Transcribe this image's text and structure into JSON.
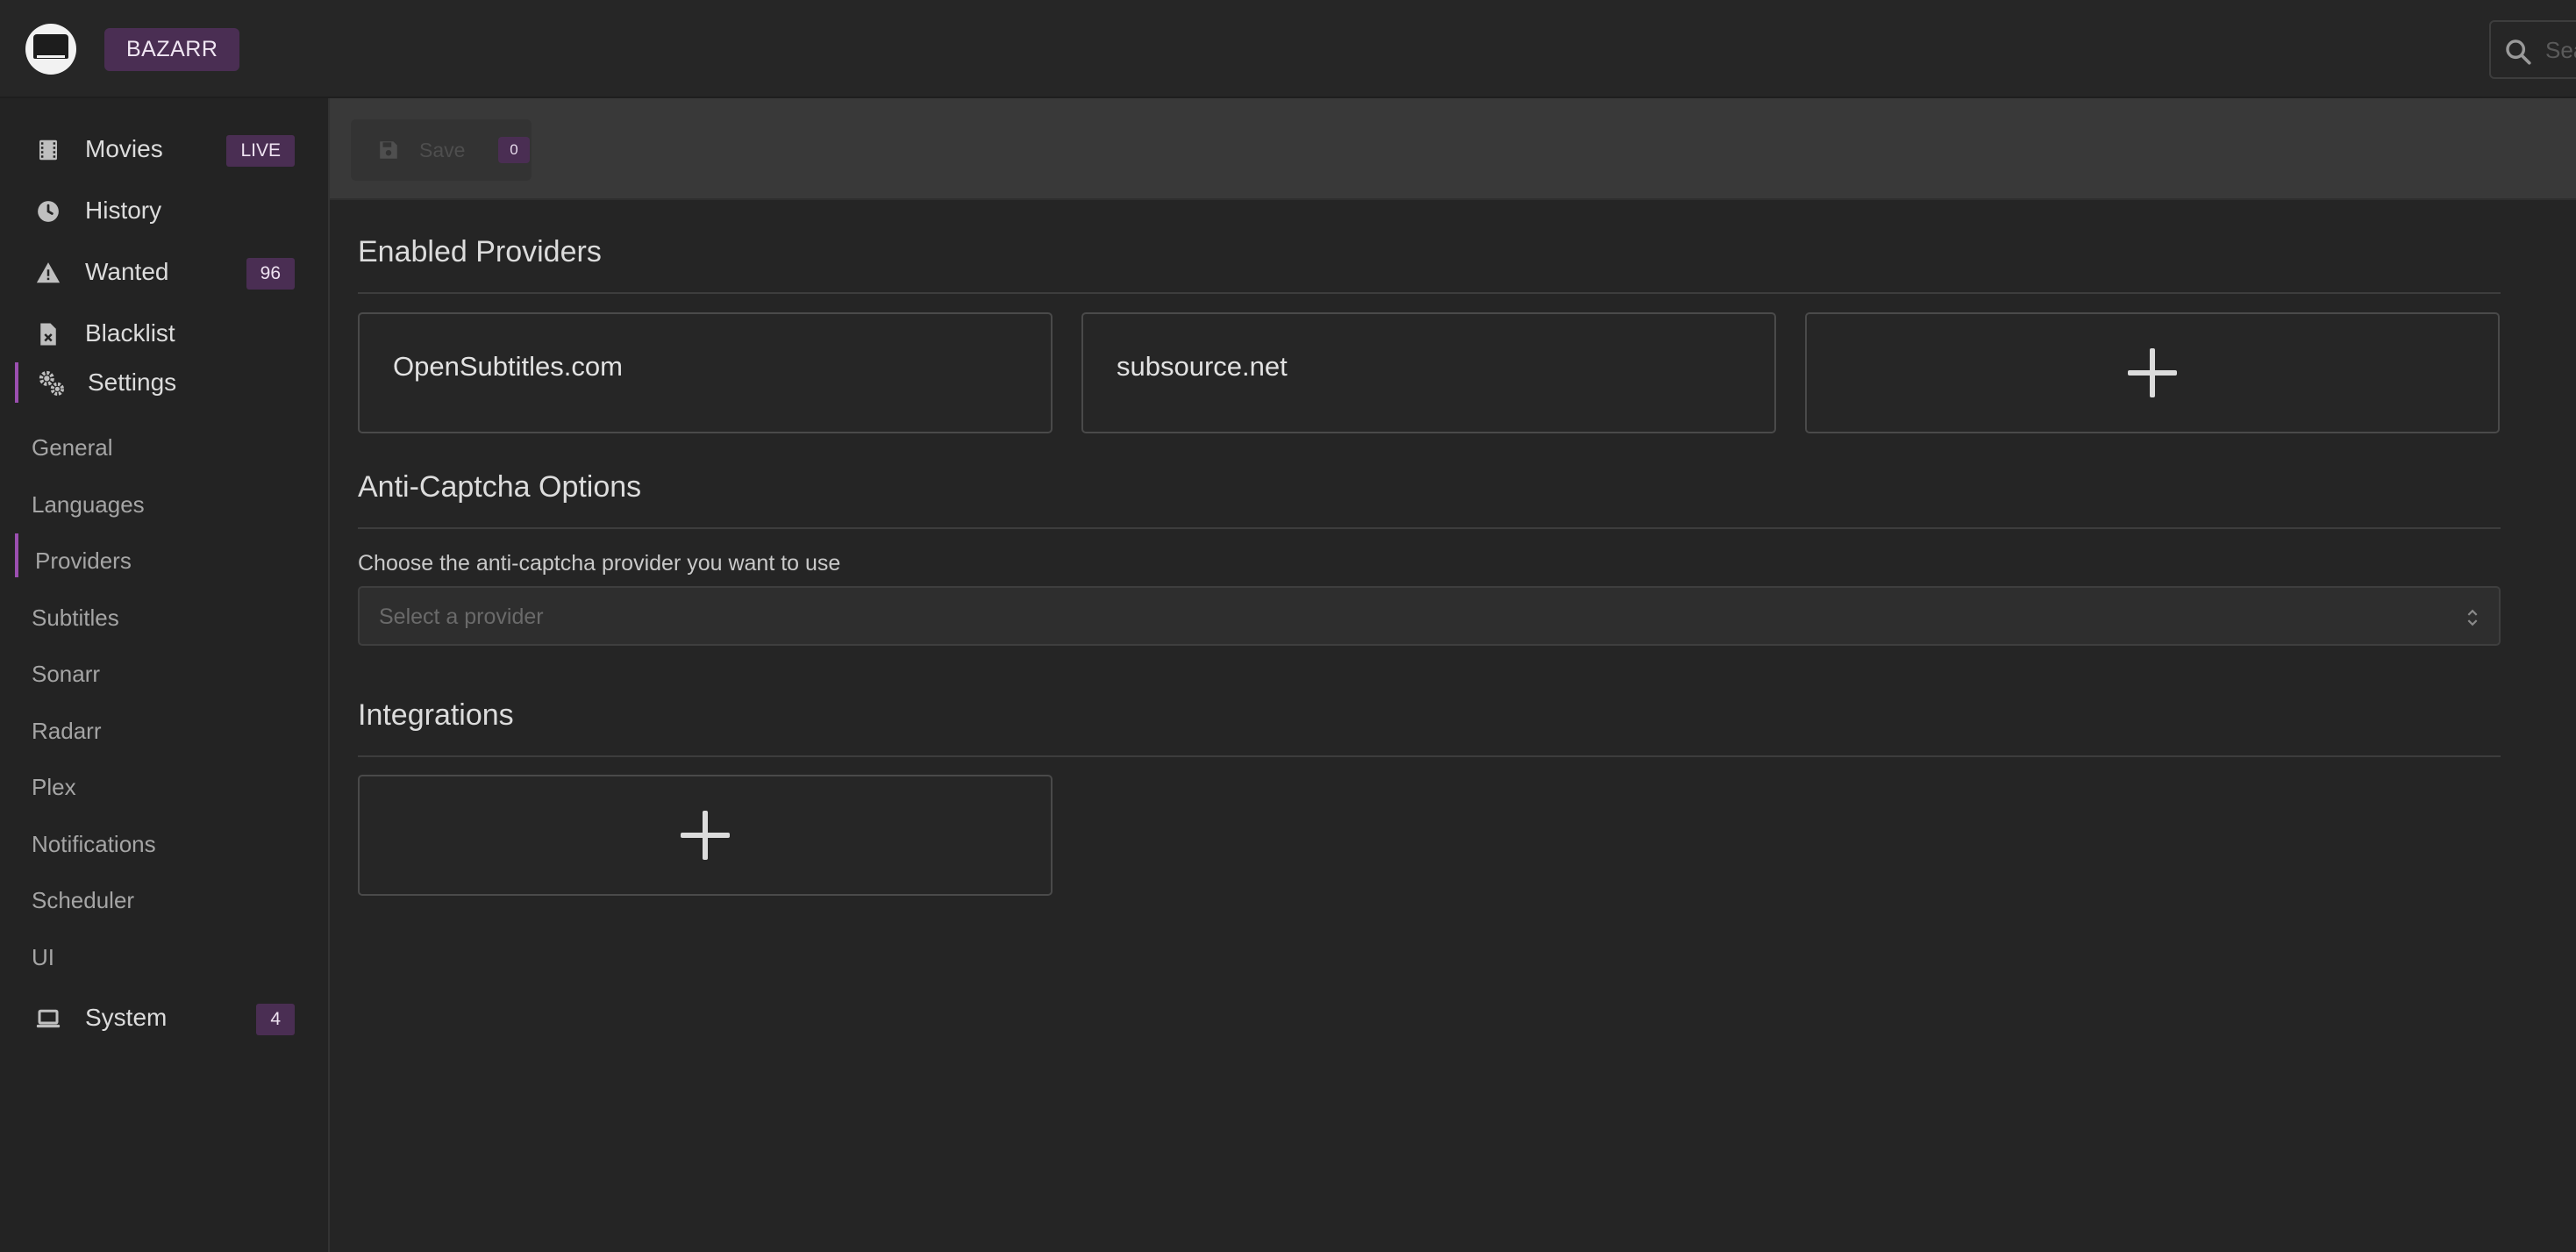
{
  "header": {
    "brand": "BAZARR",
    "search_placeholder": "Search"
  },
  "sidebar": {
    "items": [
      {
        "label": "Movies",
        "icon": "film-icon",
        "badge": "LIVE"
      },
      {
        "label": "History",
        "icon": "clock-icon"
      },
      {
        "label": "Wanted",
        "icon": "warning-icon",
        "badge": "96"
      },
      {
        "label": "Blacklist",
        "icon": "file-x-icon"
      },
      {
        "label": "Settings",
        "icon": "cogs-icon",
        "active": true
      },
      {
        "label": "System",
        "icon": "laptop-icon",
        "badge": "4"
      }
    ],
    "settings_sub": [
      "General",
      "Languages",
      "Providers",
      "Subtitles",
      "Sonarr",
      "Radarr",
      "Plex",
      "Notifications",
      "Scheduler",
      "UI"
    ],
    "active_sub": "Providers"
  },
  "toolbar": {
    "save_label": "Save",
    "save_count": "0"
  },
  "main": {
    "enabled_providers_title": "Enabled Providers",
    "providers": [
      "OpenSubtitles.com",
      "subsource.net"
    ],
    "anticaptcha_title": "Anti-Captcha Options",
    "anticaptcha_label": "Choose the anti-captcha provider you want to use",
    "anticaptcha_placeholder": "Select a provider",
    "integrations_title": "Integrations"
  },
  "colors": {
    "accent": "#4a2e53",
    "active_indicator": "#9b4fb0",
    "background": "#252525"
  }
}
